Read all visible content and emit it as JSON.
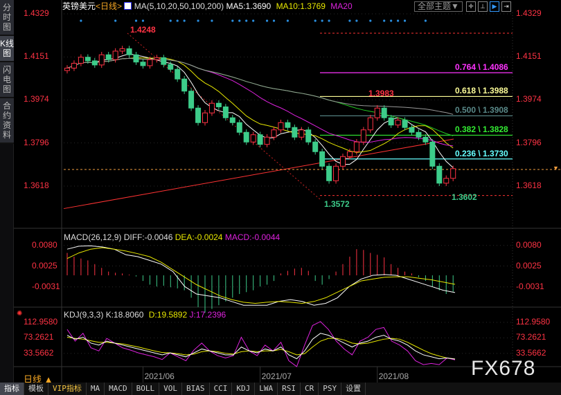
{
  "sidebar": {
    "tabs": [
      "分时图",
      "K线图",
      "闪电图",
      "合约资料"
    ],
    "active": 1
  },
  "header": {
    "symbol": "英镑美元",
    "period": "<日线>",
    "ma_title": "MA(5,10,20,50,100,200)",
    "ma5": "MA5:1.3690",
    "ma10": "MA10:1.3769",
    "ma20": "MA20",
    "theme_button": "全部主题▼"
  },
  "colors": {
    "up": "#ff3344",
    "down": "#3dcc8a",
    "ma5": "#ffffff",
    "ma10": "#e8e800",
    "ma20": "#dd22dd",
    "ma50": "#22cc22",
    "ma100": "#999999",
    "ma200": "#ff3333",
    "axis": "#ff3344"
  },
  "price_axis": {
    "labels": [
      "1.4329",
      "1.4151",
      "1.3974",
      "1.3796",
      "1.3618"
    ],
    "values": [
      1.4329,
      1.4151,
      1.3974,
      1.3796,
      1.3618
    ]
  },
  "annotations": {
    "high": "1.4248",
    "low": "1.3572",
    "swing_high": "1.3983",
    "last_low": "1.3602"
  },
  "fib_levels": [
    {
      "label": "0.764 \\ 1.4086",
      "value": 1.4086,
      "color": "#ff33ff"
    },
    {
      "label": "0.618 \\ 1.3988",
      "value": 1.3988,
      "color": "#ffff99"
    },
    {
      "label": "0.500 \\ 1.3908",
      "value": 1.3908,
      "color": "#5a8a8a"
    },
    {
      "label": "0.382 \\ 1.3828",
      "value": 1.3828,
      "color": "#33ee33"
    },
    {
      "label": "0.236 \\ 1.3730",
      "value": 1.373,
      "color": "#66ffff"
    }
  ],
  "chart_data": {
    "type": "candlestick",
    "closes": [
      1.4105,
      1.4125,
      1.415,
      1.4135,
      1.4118,
      1.416,
      1.414,
      1.4175,
      1.4185,
      1.416,
      1.413,
      1.4115,
      1.414,
      1.4148,
      1.412,
      1.41,
      1.406,
      1.401,
      1.394,
      1.388,
      1.392,
      1.396,
      1.3945,
      1.39,
      1.388,
      1.384,
      1.38,
      1.383,
      1.379,
      1.382,
      1.385,
      1.388,
      1.386,
      1.382,
      1.385,
      1.38,
      1.376,
      1.37,
      1.364,
      1.37,
      1.374,
      1.376,
      1.38,
      1.385,
      1.39,
      1.394,
      1.39,
      1.387,
      1.389,
      1.386,
      1.384,
      1.382,
      1.38,
      1.37,
      1.363,
      1.365,
      1.369
    ],
    "ma200_range": [
      1.3525,
      1.3812
    ],
    "current_price": 1.369,
    "signal_dots": [
      2,
      7,
      10,
      11,
      15,
      16,
      17,
      19,
      21,
      24,
      25,
      26,
      27,
      29,
      30,
      32,
      36,
      37,
      38,
      41,
      42,
      44,
      46,
      47,
      48,
      49,
      52
    ],
    "date_labels": [
      "2021/06",
      "2021/07",
      "2021/08"
    ],
    "date_index": [
      11,
      28,
      45
    ]
  },
  "macd": {
    "title": "MACD(26,12,9)",
    "diff": "DIFF:-0.0046",
    "dea": "DEA:-0.0024",
    "macd": "MACD:-0.0044",
    "axis": [
      "0.0080",
      "0.0025",
      "-0.0031"
    ],
    "axis_values": [
      0.008,
      0.0025,
      -0.0031
    ],
    "hist": [
      0.006,
      0.005,
      0.0045,
      0.004,
      0.003,
      0.002,
      0.001,
      0.0007,
      0.0005,
      0.0002,
      -0.0003,
      -0.0015,
      -0.0025,
      -0.003,
      -0.0028,
      -0.0032,
      -0.0035,
      -0.004,
      -0.006,
      -0.0085,
      -0.01,
      -0.009,
      -0.008,
      -0.007,
      -0.006,
      -0.005,
      -0.0045,
      -0.004,
      -0.003,
      -0.0025,
      -0.0015,
      0.0005,
      0.0012,
      0.0018,
      0.002,
      0.0012,
      -0.0015,
      -0.0025,
      -0.001,
      0.001,
      0.003,
      0.005,
      0.007,
      0.0068,
      0.006,
      0.0055,
      0.0048,
      0.003,
      0.002,
      0.001,
      0.0005,
      -0.0005,
      -0.0015,
      -0.003,
      -0.004,
      -0.005,
      -0.0044
    ],
    "diff_line": [
      0.007,
      0.0078,
      0.0079,
      0.0076,
      0.007,
      0.0055,
      0.005,
      0.004,
      0.003,
      0.001,
      -0.003,
      -0.005,
      -0.0055,
      -0.006,
      -0.007,
      -0.008,
      -0.008,
      -0.008,
      -0.007,
      -0.0065,
      -0.007,
      -0.008,
      -0.0075,
      -0.006,
      -0.003,
      -0.001,
      0.0,
      0.0002,
      0.0,
      -0.001,
      -0.002,
      -0.003,
      -0.004,
      -0.0046
    ],
    "dea_line": [
      0.0045,
      0.006,
      0.007,
      0.0074,
      0.007,
      0.0065,
      0.0058,
      0.005,
      0.0035,
      0.0015,
      -0.0005,
      -0.0025,
      -0.004,
      -0.0055,
      -0.0065,
      -0.0072,
      -0.0075,
      -0.0072,
      -0.007,
      -0.0072,
      -0.0075,
      -0.007,
      -0.006,
      -0.0045,
      -0.003,
      -0.0015,
      -0.001,
      -0.0005,
      -0.0004,
      -0.0004,
      -0.0008,
      -0.0012,
      -0.0018,
      -0.0024
    ]
  },
  "kdj": {
    "title": "KDJ(9,3,3)",
    "k": "K:18.8060",
    "d": "D:19.5892",
    "j": "J:17.2396",
    "axis": [
      "112.9580",
      "73.2621",
      "33.5662"
    ],
    "axis_values": [
      112.958,
      73.2621,
      33.5662
    ],
    "k_line": [
      80,
      70,
      75,
      60,
      55,
      65,
      60,
      55,
      50,
      45,
      40,
      35,
      30,
      35,
      30,
      25,
      35,
      45,
      40,
      35,
      30,
      30,
      50,
      40,
      35,
      45,
      40,
      50,
      30,
      20,
      40,
      70,
      85,
      80,
      70,
      60,
      50,
      60,
      65,
      75,
      80,
      70,
      65,
      55,
      40,
      30,
      25,
      20,
      22,
      19
    ],
    "d_line": [
      75,
      72,
      70,
      66,
      62,
      62,
      60,
      58,
      54,
      50,
      45,
      40,
      36,
      35,
      33,
      30,
      32,
      38,
      40,
      38,
      34,
      32,
      38,
      40,
      38,
      40,
      40,
      44,
      38,
      30,
      33,
      50,
      65,
      72,
      72,
      68,
      60,
      58,
      60,
      65,
      70,
      72,
      70,
      62,
      52,
      42,
      33,
      27,
      22,
      19.6
    ],
    "j_line": [
      95,
      65,
      85,
      48,
      40,
      72,
      60,
      48,
      42,
      35,
      30,
      25,
      18,
      35,
      25,
      15,
      42,
      60,
      40,
      28,
      22,
      28,
      75,
      40,
      28,
      55,
      40,
      62,
      15,
      0,
      55,
      105,
      115,
      95,
      65,
      45,
      30,
      65,
      75,
      95,
      100,
      65,
      55,
      40,
      15,
      5,
      8,
      5,
      22,
      17
    ]
  },
  "date_axis": {
    "period": "日线",
    "arrow": "▲"
  },
  "watermark": "FX678",
  "toolbar": [
    "指标",
    "模板",
    "VIP指标",
    "MA",
    "MACD",
    "BOLL",
    "VOL",
    "BIAS",
    "CCI",
    "KDJ",
    "LWA",
    "RSI",
    "CR",
    "PSY",
    "设置"
  ]
}
